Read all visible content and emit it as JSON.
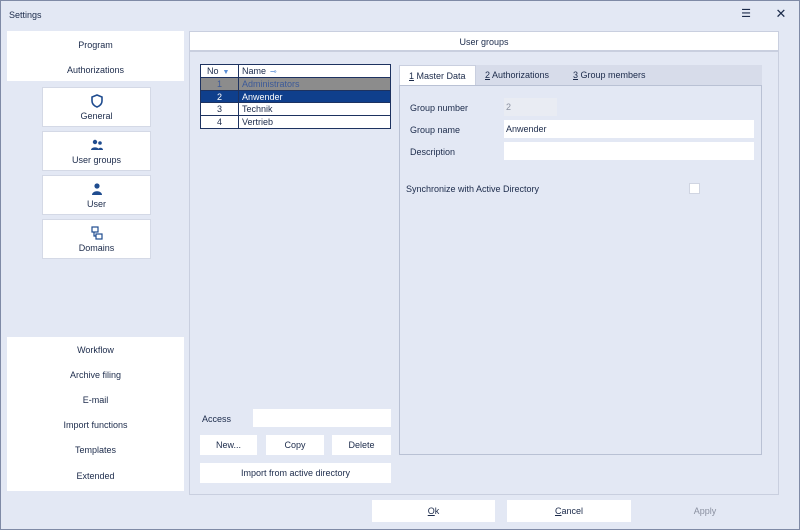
{
  "window": {
    "title": "Settings",
    "maximize_icon": "☰",
    "close_icon": "✕"
  },
  "leftnav": {
    "top_items": [
      {
        "label": "Program"
      },
      {
        "label": "Authorizations"
      }
    ],
    "tiles": [
      {
        "label": "General",
        "icon": "shield-icon"
      },
      {
        "label": "User groups",
        "icon": "users-icon"
      },
      {
        "label": "User",
        "icon": "user-icon"
      },
      {
        "label": "Domains",
        "icon": "domains-icon"
      }
    ],
    "bottom_items": [
      {
        "label": "Workflow"
      },
      {
        "label": "Archive filing"
      },
      {
        "label": "E-mail"
      },
      {
        "label": "Import functions"
      },
      {
        "label": "Templates"
      },
      {
        "label": "Extended"
      }
    ]
  },
  "main": {
    "header": "User groups",
    "grid": {
      "columns": {
        "no": "No",
        "name": "Name"
      },
      "rows": [
        {
          "no": "1",
          "name": "Administrators",
          "state": "disabled"
        },
        {
          "no": "2",
          "name": "Anwender",
          "state": "selected"
        },
        {
          "no": "3",
          "name": "Technik",
          "state": "normal"
        },
        {
          "no": "4",
          "name": "Vertrieb",
          "state": "normal"
        }
      ]
    },
    "access": {
      "label": "Access",
      "value": ""
    },
    "buttons": {
      "new": "New...",
      "copy": "Copy",
      "delete": "Delete",
      "import": "Import from active directory"
    },
    "tabs": [
      {
        "key": "1",
        "label": " Master Data"
      },
      {
        "key": "2",
        "label": " Authorizations"
      },
      {
        "key": "3",
        "label": " Group members"
      }
    ],
    "form": {
      "group_number": {
        "label": "Group number",
        "value": "2"
      },
      "group_name": {
        "label": "Group name",
        "value": "Anwender"
      },
      "description": {
        "label": "Description",
        "value": ""
      },
      "sync_ad": {
        "label": "Synchronize with Active Directory",
        "checked": false
      }
    }
  },
  "footer": {
    "ok": {
      "key": "O",
      "rest": "k"
    },
    "cancel": {
      "key": "C",
      "rest": "ancel"
    },
    "apply": "Apply"
  },
  "colors": {
    "background": "#e3e8f4",
    "selected_row": "#0f3f8c",
    "disabled_row": "#8c8c8c",
    "accent": "#5b8fd6"
  }
}
